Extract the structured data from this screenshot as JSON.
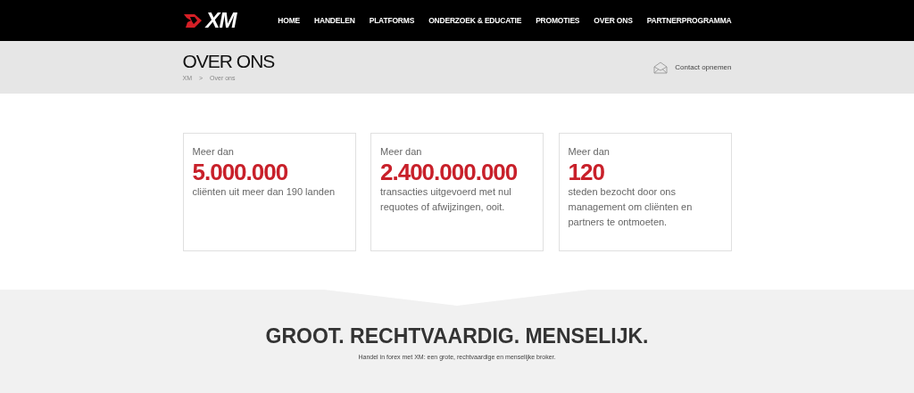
{
  "logo": {
    "text": "XM"
  },
  "nav": [
    {
      "label": "HOME",
      "selected": false
    },
    {
      "label": "HANDELEN",
      "selected": false
    },
    {
      "label": "PLATFORMS",
      "selected": false
    },
    {
      "label": "ONDERZOEK & EDUCATIE",
      "selected": false
    },
    {
      "label": "PROMOTIES",
      "selected": false
    },
    {
      "label": "OVER ONS",
      "selected": false
    },
    {
      "label": "PARTNERPROGRAMMA",
      "selected": false
    }
  ],
  "page_header": {
    "title": "OVER ONS",
    "breadcrumb": [
      "XM",
      ">",
      "Over ons"
    ],
    "contact": "Contact opnemen"
  },
  "stats": [
    {
      "prefix": "Meer dan",
      "number": "5.000.000",
      "text": "cliënten uit meer dan 190 landen"
    },
    {
      "prefix": "Meer dan",
      "number": "2.400.000.000",
      "text": "transacties uitgevoerd met nul requotes of afwijzingen, ooit."
    },
    {
      "prefix": "Meer dan",
      "number": "120",
      "text": "steden bezocht door ons management om cliënten en partners te ontmoeten."
    }
  ],
  "banner": {
    "headline": "GROOT. RECHTVAARDIG. MENSELIJK.",
    "subtitle": "Handel in forex met XM: een grote, rechtvaardige en menselijke broker."
  }
}
